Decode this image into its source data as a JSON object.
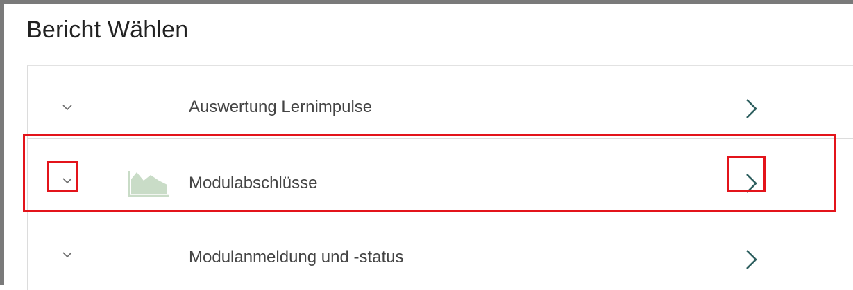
{
  "page": {
    "title": "Bericht Wählen"
  },
  "reports": [
    {
      "label": "Auswertung Lernimpulse",
      "has_icon": false,
      "highlighted": false
    },
    {
      "label": "Modulabschlüsse",
      "has_icon": true,
      "icon": "area-chart-icon",
      "highlighted": true
    },
    {
      "label": "Modulanmeldung und -status",
      "has_icon": false,
      "highlighted": false
    }
  ],
  "icons": {
    "expand": "chevron-down-icon",
    "open": "chevron-right-icon"
  },
  "colors": {
    "highlight": "#e3141b",
    "chevron_open": "#2e5f5f",
    "chevron_expand": "#6b6b6b",
    "chart_icon": "#c9dcc7",
    "text": "#444444",
    "title": "#222222"
  }
}
